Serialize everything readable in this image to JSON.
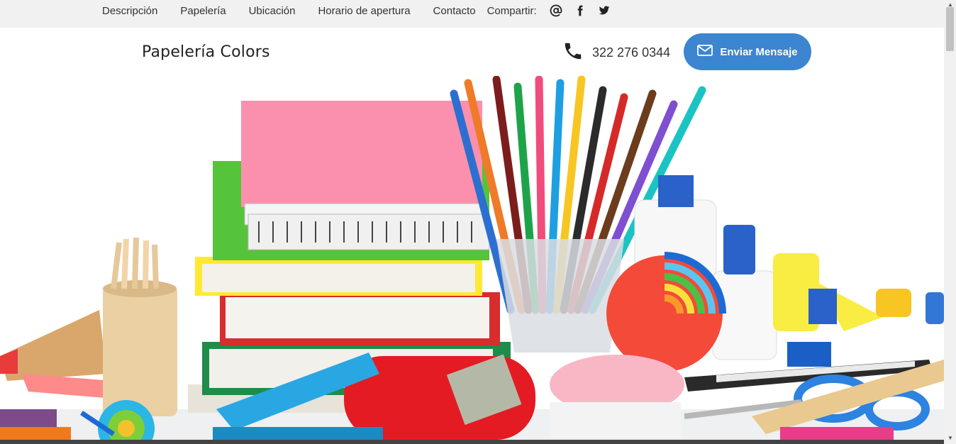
{
  "topnav": {
    "items": [
      "Descripción",
      "Papelería",
      "Ubicación",
      "Horario de apertura",
      "Contacto"
    ],
    "share_label": "Compartir:",
    "share_icons": [
      "at-icon",
      "facebook-icon",
      "twitter-icon"
    ]
  },
  "header": {
    "brand": "Papelería Colors",
    "phone": "322 276 0344",
    "message_button": "Enviar Mensaje"
  },
  "colors": {
    "accent": "#3c85d1",
    "topbar_bg": "#f1f1f1"
  },
  "hero": {
    "image_description_icon": "school-supplies-photo"
  }
}
